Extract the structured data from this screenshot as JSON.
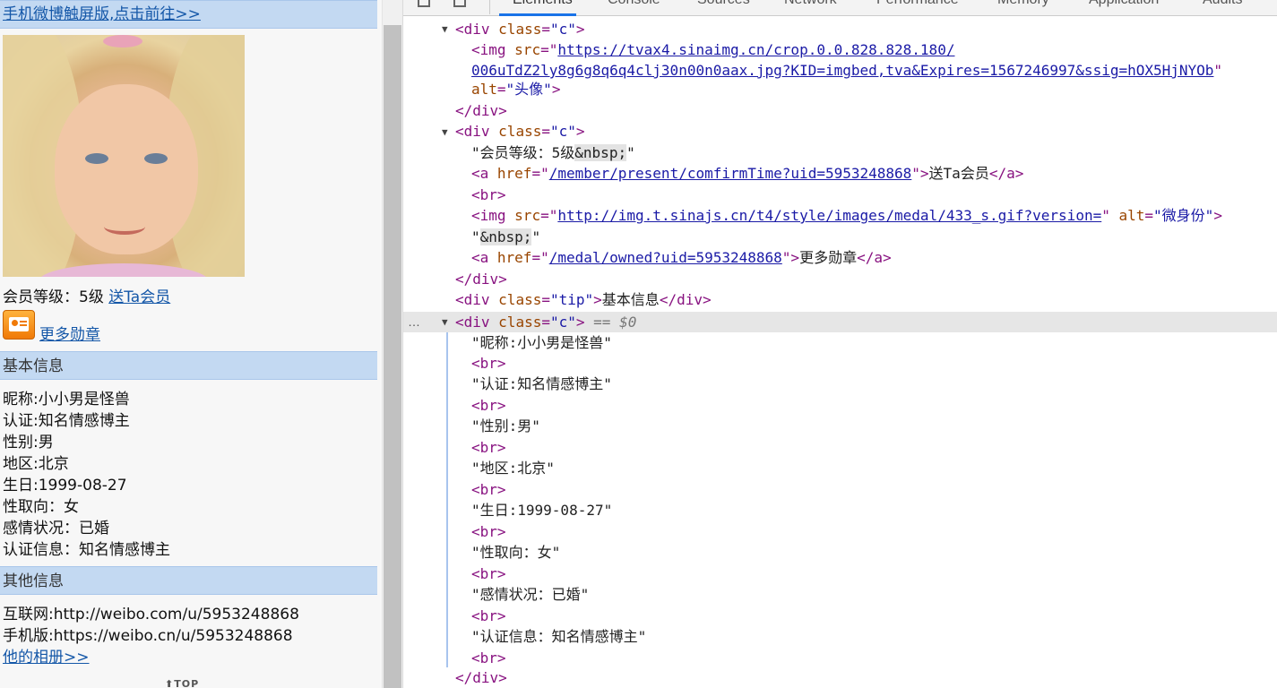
{
  "page": {
    "top_link": "手机微博触屏版,点击前往>>",
    "member_level_text": "会员等级：5级",
    "gift_link": "送Ta会员",
    "more_medals_link": "更多勋章",
    "basic_info_tip": "基本信息",
    "basic_info": [
      "昵称:小小男是怪兽",
      "认证:知名情感博主",
      "性别:男",
      "地区:北京",
      "生日:1999-08-27",
      "性取向：女",
      "感情状况：已婚",
      "认证信息：知名情感博主"
    ],
    "other_info_tip": "其他信息",
    "internet_text": "互联网:http://weibo.com/u/5953248868",
    "mobile_text": "手机版:https://weibo.cn/u/5953248868",
    "album_link": "他的相册>>",
    "top_button": "TOP"
  },
  "devtools": {
    "tabs": [
      "Elements",
      "Console",
      "Sources",
      "Network",
      "Performance",
      "Memory",
      "Application",
      "Audits"
    ],
    "active_tab": "Elements",
    "lines": {
      "l1_tag_open": "<div",
      "l1_attr": "class",
      "l1_val": "\"c\"",
      "l2_tag": "<img",
      "l2_attr": "src",
      "l2_url_a": "https://tvax4.sinaimg.cn/crop.0.0.828.828.180/",
      "l3_url_b": "006uTdZ2ly8g6g8q6q4clj30n00n0aax.jpg?KID=imgbed,tva&Expires=1567246997&ssig=hOX5HjNYOb",
      "l4_attr": "alt",
      "l4_val": "\"头像\"",
      "close_div": "</div>",
      "l6_val": "\"c\"",
      "l7_text": "\"会员等级：5级",
      "nbsp": "&nbsp;",
      "l8_attr": "href",
      "l8_url": "/member/present/comfirmTime?uid=5953248868",
      "l8_text": "送Ta会员",
      "br": "<br>",
      "l10_url": "http://img.t.sinajs.cn/t4/style/images/medal/433_s.gif?version=",
      "l10_alt_val": "\"微身份\"",
      "l12_url": "/medal/owned?uid=5953248868",
      "l12_text": "更多勋章",
      "tip_val": "\"tip\"",
      "tip_text": "基本信息",
      "eq_dollar": "== $0",
      "dots": "…",
      "text_nickname": "\"昵称:小小男是怪兽\"",
      "text_verify": "\"认证:知名情感博主\"",
      "text_gender": "\"性别:男\"",
      "text_region": "\"地区:北京\"",
      "text_birthday": "\"生日:1999-08-27\"",
      "text_orientation": "\"性取向：女\"",
      "text_relationship": "\"感情状况：已婚\"",
      "text_verify_info": "\"认证信息：知名情感博主\""
    }
  }
}
